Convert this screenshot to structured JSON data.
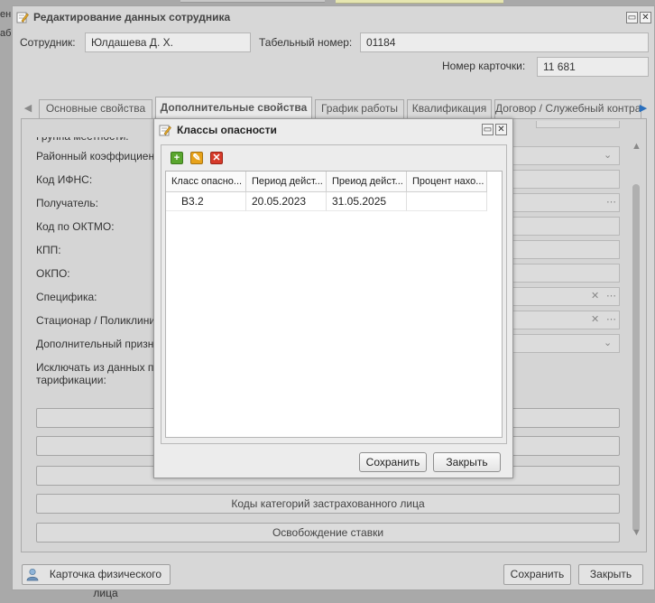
{
  "background": {
    "left_fragments": [
      "ен",
      "аб"
    ]
  },
  "main_window": {
    "title": "Редактирование данных сотрудника",
    "employee_label": "Сотрудник:",
    "employee_value": "Юлдашева Д. Х.",
    "tab_number_label": "Табельный номер:",
    "tab_number_value": "01184",
    "card_number_label": "Номер карточки:",
    "card_number_value": "11 681",
    "tabs": [
      {
        "label": "Основные свойства"
      },
      {
        "label": "Дополнительные свойства"
      },
      {
        "label": "График работы"
      },
      {
        "label": "Квалификация"
      },
      {
        "label": "Договор / Служебный контракт"
      }
    ],
    "fields": [
      {
        "label": "Группа местности:"
      },
      {
        "label": "Районный коэффициент:"
      },
      {
        "label": "Код ИФНС:"
      },
      {
        "label": "Получатель:"
      },
      {
        "label": "Код по ОКТМО:"
      },
      {
        "label": "КПП:"
      },
      {
        "label": "ОКПО:"
      },
      {
        "label": "Специфика:"
      },
      {
        "label": "Стационар / Поликлиника:"
      },
      {
        "label": "Дополнительный признак:"
      }
    ],
    "exclude_label": "Исключать из данных по тарификации:",
    "panel_buttons": [
      {
        "label": ""
      },
      {
        "label": ""
      },
      {
        "label": ""
      },
      {
        "label": "Коды категорий застрахованного лица"
      },
      {
        "label": "Освобождение ставки"
      }
    ],
    "footer": {
      "person_card_button": "Карточка физического лица",
      "save_button": "Сохранить",
      "close_button": "Закрыть"
    }
  },
  "dialog": {
    "title": "Классы опасности",
    "columns": [
      "Класс опасно...",
      "Период дейст...",
      "Преиод дейст...",
      "Процент нахо..."
    ],
    "rows": [
      [
        "В3.2",
        "20.05.2023",
        "31.05.2025",
        ""
      ]
    ],
    "save_button": "Сохранить",
    "close_button": "Закрыть"
  },
  "colors": {
    "add": "#5aa62e",
    "edit": "#e7a21a",
    "delete": "#d63a2a"
  }
}
